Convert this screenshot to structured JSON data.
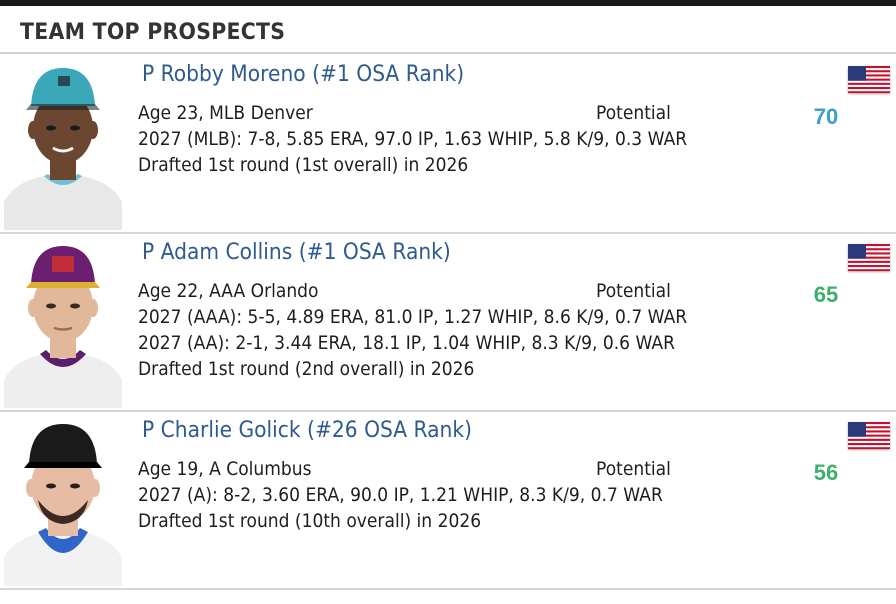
{
  "panel": {
    "title": "TEAM TOP PROSPECTS"
  },
  "prospects": [
    {
      "name": "P Robby Moreno (#1 OSA Rank)",
      "bio": "Age 23, MLB Denver",
      "potential_label": "Potential",
      "potential": "70",
      "potential_color": "#3aa0c8",
      "stats": [
        "2027 (MLB): 7-8, 5.85 ERA, 97.0 IP, 1.63 WHIP, 5.8 K/9, 0.3 WAR"
      ],
      "draft": "Drafted 1st round (1st overall) in 2026",
      "cap_color": "#3aa8b8",
      "jersey_color": "#e8e8e8",
      "collar_color": "#6fc0d8",
      "skin_color": "#6b4630",
      "flag": "us-flag-icon"
    },
    {
      "name": "P Adam Collins (#1 OSA Rank)",
      "bio": "Age 22, AAA Orlando",
      "potential_label": "Potential",
      "potential": "65",
      "potential_color": "#3cb06a",
      "stats": [
        "2027 (AAA): 5-5, 4.89 ERA, 81.0 IP, 1.27 WHIP, 8.6 K/9, 0.7 WAR",
        "2027 (AA): 2-1, 3.44 ERA, 18.1 IP, 1.04 WHIP, 8.3 K/9, 0.6 WAR"
      ],
      "draft": "Drafted 1st round (2nd overall) in 2026",
      "cap_color": "#6b1f6e",
      "jersey_color": "#eeeeee",
      "collar_color": "#5e1f6a",
      "skin_color": "#e2b89a",
      "flag": "us-flag-icon"
    },
    {
      "name": "P Charlie Golick (#26 OSA Rank)",
      "bio": "Age 19, A Columbus",
      "potential_label": "Potential",
      "potential": "56",
      "potential_color": "#3cb06a",
      "stats": [
        "2027 (A): 8-2, 3.60 ERA, 90.0 IP, 1.21 WHIP, 8.3 K/9, 0.7 WAR"
      ],
      "draft": "Drafted 1st round (10th overall) in 2026",
      "cap_color": "#1a1a1a",
      "jersey_color": "#f2f2f2",
      "collar_color": "#2f66c8",
      "skin_color": "#e7bca4",
      "flag": "us-flag-icon"
    }
  ]
}
